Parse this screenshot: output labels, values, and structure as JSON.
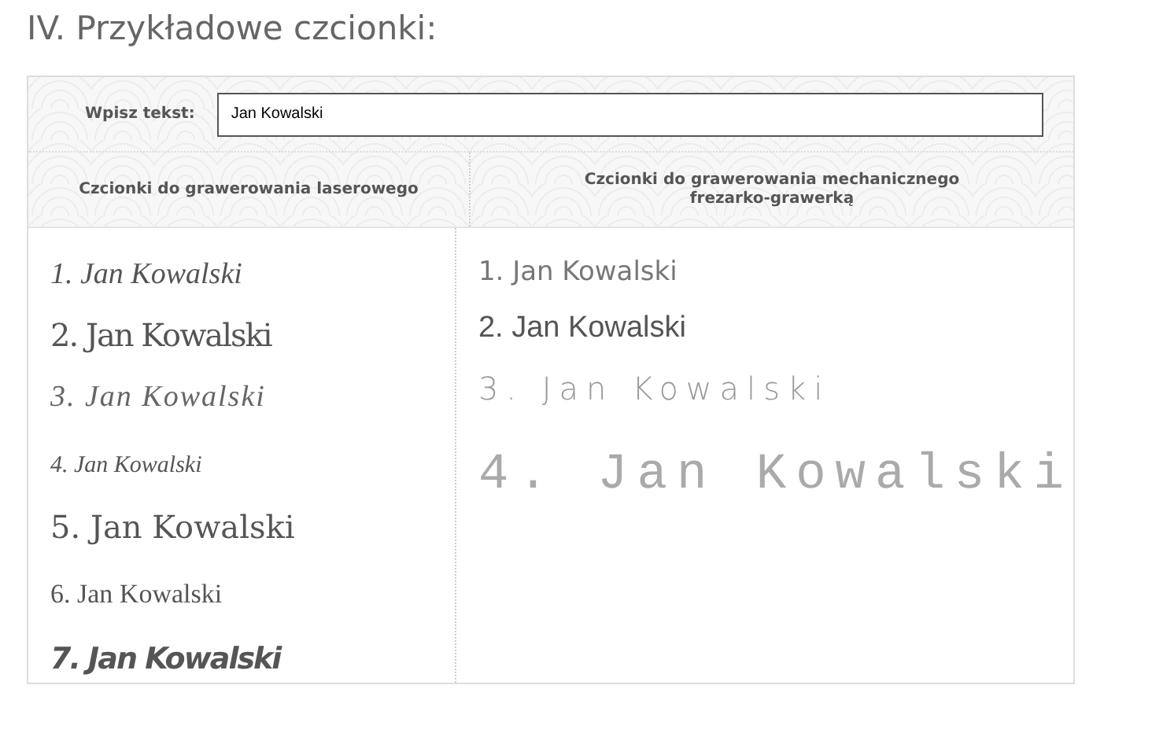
{
  "heading": "IV. Przykładowe czcionki:",
  "text_input": {
    "label": "Wpisz tekst:",
    "value": "Jan Kowalski"
  },
  "columns": [
    {
      "header": "Czcionki do grawerowania laserowego",
      "samples": [
        "1. Jan Kowalski",
        "2. Jan Kowalski",
        "3.  Jan Kowalski",
        "4. Jan Kowalski",
        "5. Jan Kowalski",
        "6. Jan Kowalski",
        "7. Jan Kowalski"
      ]
    },
    {
      "header": "Czcionki do grawerowania mechanicznego frezarko-grawerką",
      "samples": [
        "1. Jan Kowalski",
        "2. Jan Kowalski",
        "3. Jan Kowalski",
        "4. Jan Kowalski"
      ]
    }
  ]
}
